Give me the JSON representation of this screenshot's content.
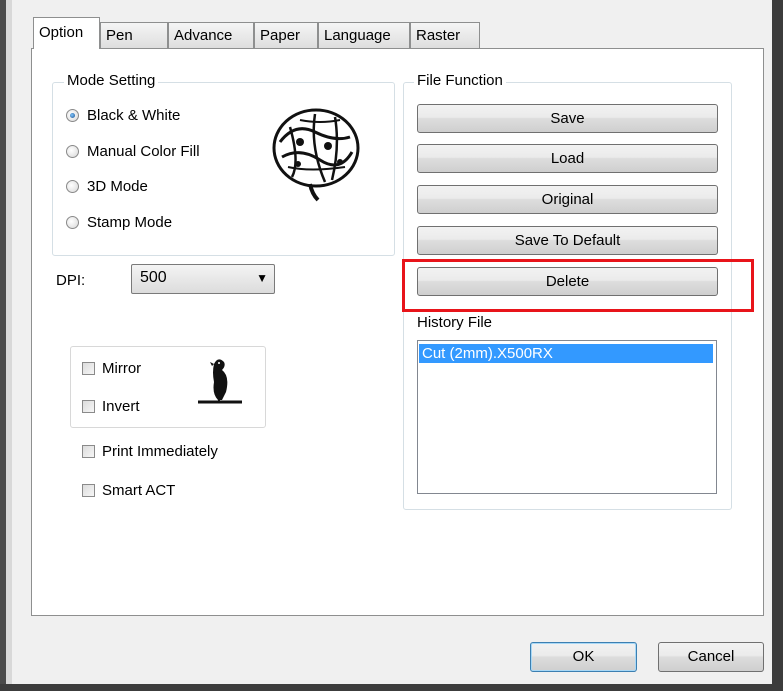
{
  "tabs": [
    "Option",
    "Pen",
    "Advance",
    "Paper",
    "Language",
    "Raster"
  ],
  "mode_setting": {
    "title": "Mode Setting",
    "options": [
      "Black & White",
      "Manual Color Fill",
      "3D Mode",
      "Stamp Mode"
    ],
    "selected": "Black & White"
  },
  "dpi": {
    "label": "DPI:",
    "value": "500"
  },
  "checks": {
    "mirror": "Mirror",
    "invert": "Invert",
    "print_immediately": "Print Immediately",
    "smart_act": "Smart ACT"
  },
  "file_function": {
    "title": "File Function",
    "buttons": [
      "Save",
      "Load",
      "Original",
      "Save To Default",
      "Delete"
    ],
    "highlighted": "Delete"
  },
  "history": {
    "label": "History File",
    "items": [
      "Cut  (2mm).X500RX"
    ],
    "selected_index": 0
  },
  "footer": {
    "ok": "OK",
    "cancel": "Cancel"
  },
  "colors": {
    "highlight_box": "#e8141a",
    "selection": "#3399ff"
  },
  "icons": [
    "brain-image-icon",
    "bird-icon",
    "dropdown-arrow-icon"
  ]
}
